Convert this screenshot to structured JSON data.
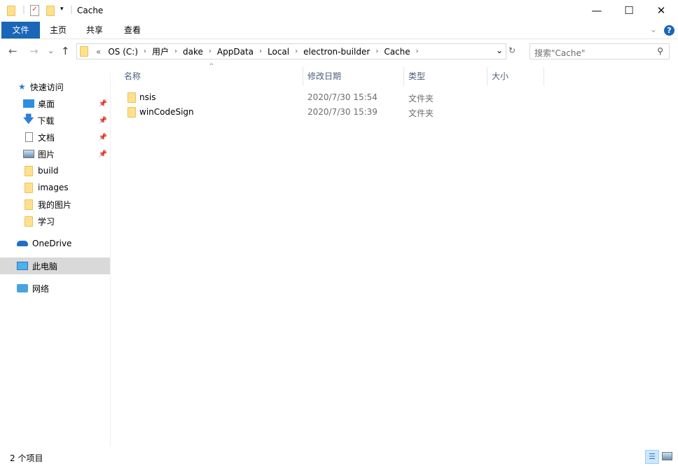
{
  "window": {
    "title": "Cache",
    "minimize": "—",
    "maximize": "☐",
    "close": "✕"
  },
  "ribbon": {
    "tabs": [
      "文件",
      "主页",
      "共享",
      "查看"
    ],
    "help": "?",
    "expand": "⌄"
  },
  "address": {
    "crumbs": [
      "«",
      "OS (C:)",
      "用户",
      "dake",
      "AppData",
      "Local",
      "electron-builder",
      "Cache"
    ],
    "dropdown": "⌄",
    "refresh": "↻"
  },
  "search": {
    "placeholder": "搜索\"Cache\"",
    "icon": "search-icon"
  },
  "nav": {
    "back": "←",
    "forward": "→",
    "recent": "⌄",
    "up": "↑"
  },
  "sidebar": {
    "items": [
      {
        "label": "快速访问",
        "icon": "star-icon"
      },
      {
        "label": "桌面",
        "icon": "desktop-icon",
        "pinned": true
      },
      {
        "label": "下载",
        "icon": "download-icon",
        "pinned": true
      },
      {
        "label": "文档",
        "icon": "document-icon",
        "pinned": true
      },
      {
        "label": "图片",
        "icon": "pictures-icon",
        "pinned": true
      },
      {
        "label": "build",
        "icon": "folder-icon"
      },
      {
        "label": "images",
        "icon": "folder-icon"
      },
      {
        "label": "我的图片",
        "icon": "folder-icon"
      },
      {
        "label": "学习",
        "icon": "folder-icon"
      },
      {
        "label": "OneDrive",
        "icon": "cloud-icon"
      },
      {
        "label": "此电脑",
        "icon": "computer-icon"
      },
      {
        "label": "网络",
        "icon": "network-icon"
      }
    ]
  },
  "columns": [
    "名称",
    "修改日期",
    "类型",
    "大小"
  ],
  "files": [
    {
      "name": "nsis",
      "date": "2020/7/30 15:54",
      "type": "文件夹",
      "size": ""
    },
    {
      "name": "winCodeSign",
      "date": "2020/7/30 15:39",
      "type": "文件夹",
      "size": ""
    }
  ],
  "status": {
    "count": "2 个项目"
  }
}
